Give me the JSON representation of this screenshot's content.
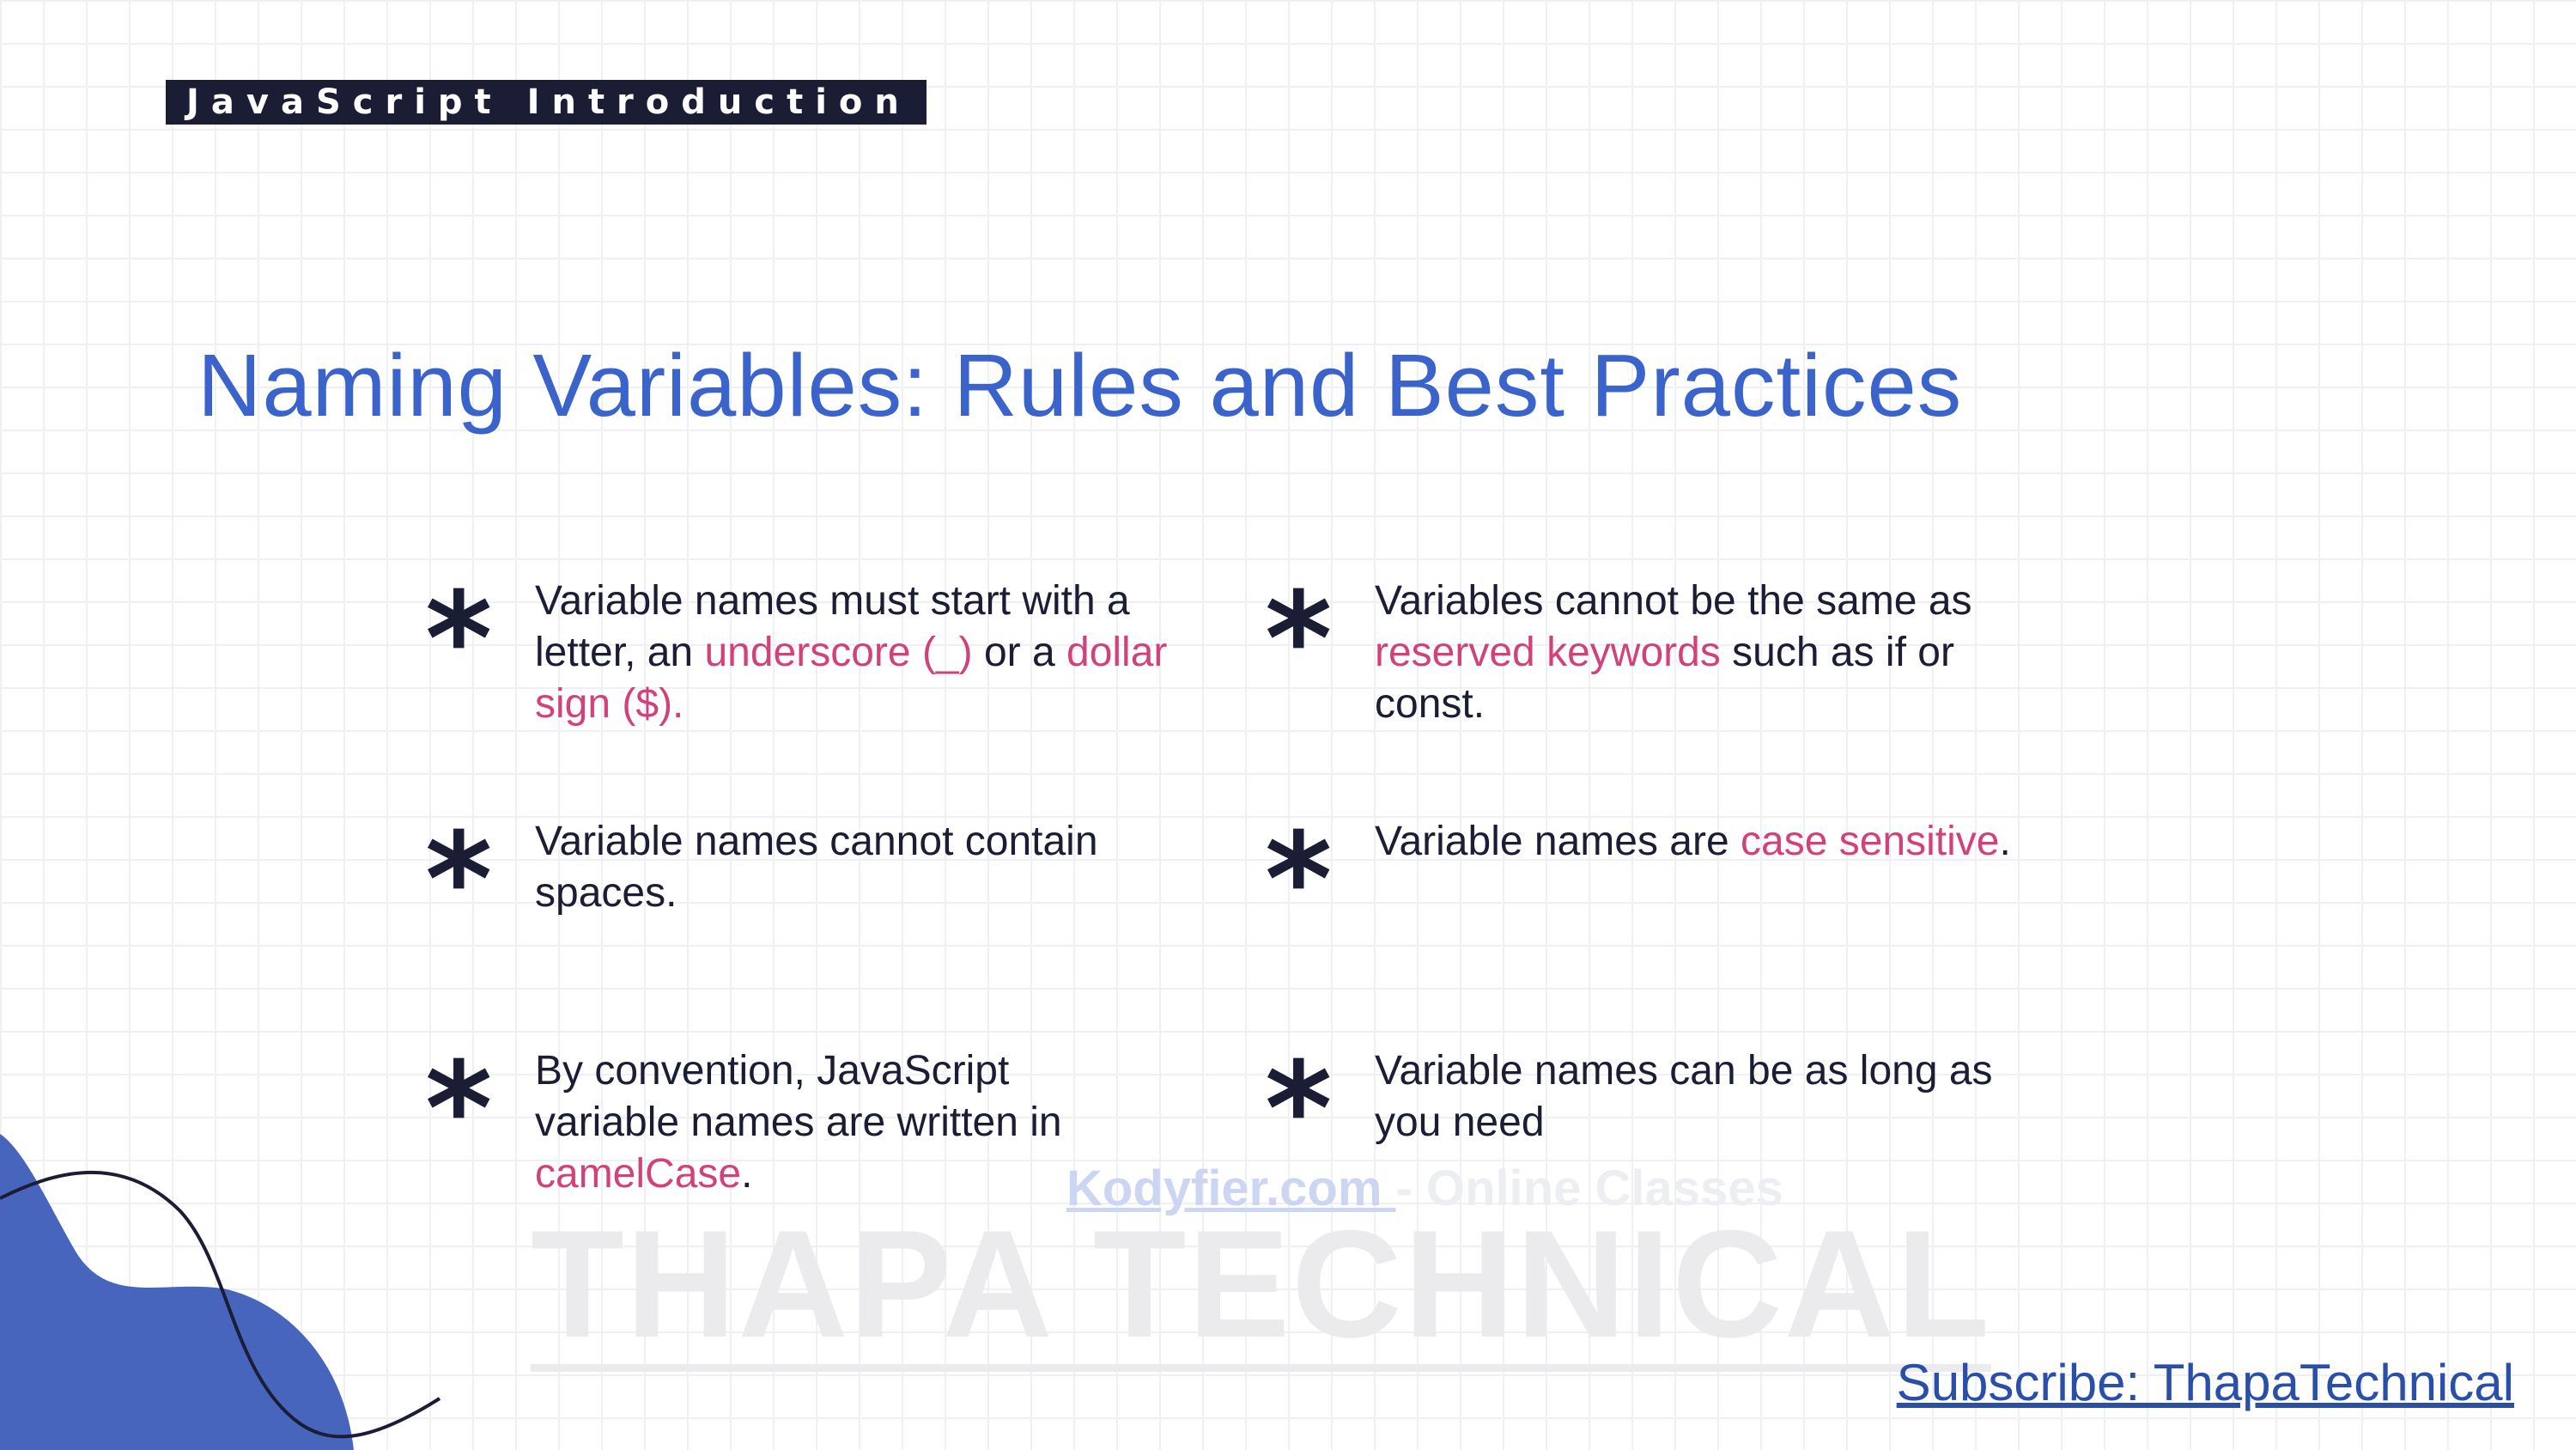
{
  "header": {
    "tag": "JavaScript Introduction"
  },
  "title": "Naming Variables: Rules and Best Practices",
  "rules": [
    {
      "before": "Variable names must start with a letter, an ",
      "highlight": "underscore (_)",
      "mid": " or a ",
      "highlight2": "dollar sign ($).",
      "after": ""
    },
    {
      "before": "Variables cannot be the same as ",
      "highlight": "reserved keywords",
      "after": " such as if or const."
    },
    {
      "before": "Variable names cannot contain spaces."
    },
    {
      "before": "Variable names are ",
      "highlight": "case sensitive",
      "after": "."
    },
    {
      "before": "By convention, JavaScript variable names are written in ",
      "highlight": "camelCase",
      "after": "."
    },
    {
      "before": "Variable names can be as long as you need"
    }
  ],
  "bullet_symbol": "*",
  "watermark": {
    "link": "Kodyfier.com ",
    "rest": "- Online Classes",
    "brand": "THAPA TECHNICAL"
  },
  "subscribe": "Subscribe: ThapaTechnical",
  "colors": {
    "title": "#3a63cc",
    "highlight": "#d2417a",
    "dark": "#1b1d35",
    "blob": "#4765bd"
  }
}
